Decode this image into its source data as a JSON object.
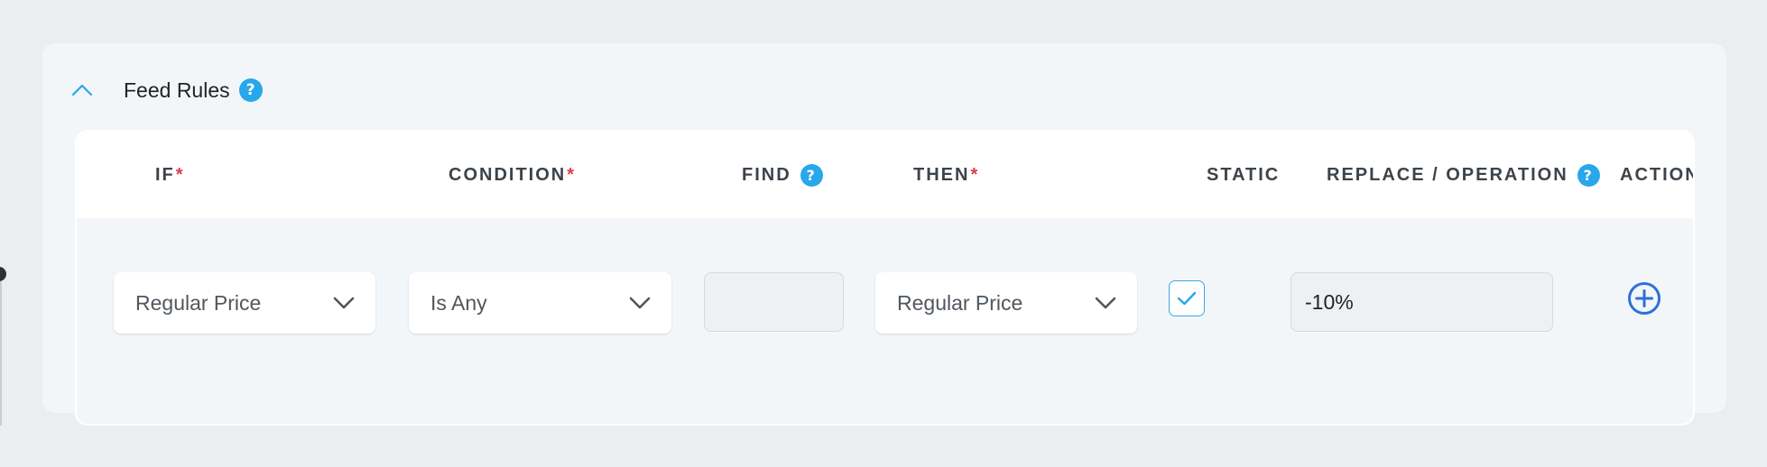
{
  "section": {
    "title": "Feed Rules",
    "help_icon": "question-icon"
  },
  "table": {
    "headers": [
      {
        "label": "IF",
        "required": "*"
      },
      {
        "label": "CONDITION",
        "required": "*"
      },
      {
        "label": "FIND",
        "help": "?"
      },
      {
        "label": "THEN",
        "required": "*"
      },
      {
        "label": "STATIC"
      },
      {
        "label": "REPLACE / OPERATION",
        "help": "?"
      },
      {
        "label": "ACTION"
      }
    ],
    "row": {
      "if_value": "Regular Price",
      "condition_value": "Is Any",
      "find_value": "",
      "then_value": "Regular Price",
      "static_checked": true,
      "replace_value": "-10%",
      "action_icon": "plus-circle-icon"
    }
  },
  "colors": {
    "accent": "#27a8ea",
    "required": "#e03c4c",
    "action": "#2f6fdb"
  }
}
